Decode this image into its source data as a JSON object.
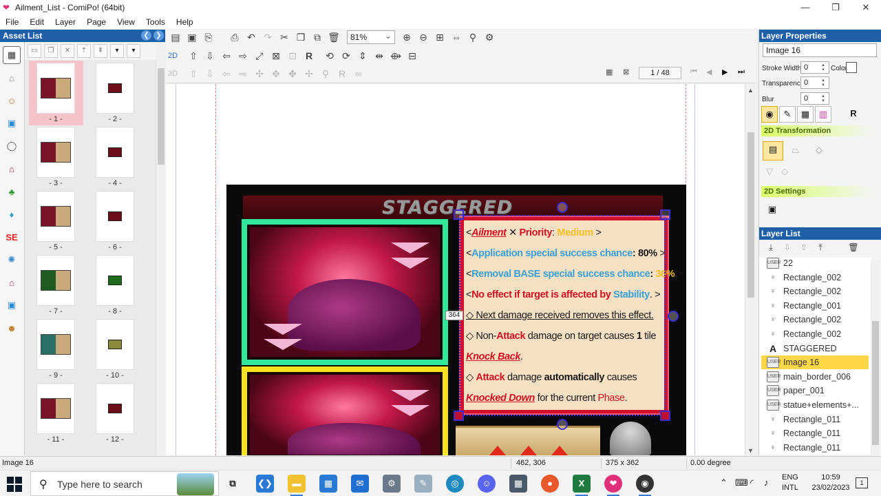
{
  "window": {
    "title": "Ailment_List - ComiPo! (64bit)",
    "controls": [
      "—",
      "❐",
      "✕"
    ]
  },
  "menu": [
    "File",
    "Edit",
    "Layer",
    "Page",
    "View",
    "Tools",
    "Help"
  ],
  "asset_list": {
    "title": "Asset List",
    "pages": [
      {
        "label": "- 1 -",
        "variant": "red-big"
      },
      {
        "label": "- 2 -",
        "variant": "red-small"
      },
      {
        "label": "- 3 -",
        "variant": "red-big"
      },
      {
        "label": "- 4 -",
        "variant": "red-small"
      },
      {
        "label": "- 5 -",
        "variant": "red-big"
      },
      {
        "label": "- 6 -",
        "variant": "red-small"
      },
      {
        "label": "- 7 -",
        "variant": "green-big"
      },
      {
        "label": "- 8 -",
        "variant": "green-small"
      },
      {
        "label": "- 9 -",
        "variant": "teal-big"
      },
      {
        "label": "- 10 -",
        "variant": "teal-small"
      },
      {
        "label": "- 11 -",
        "variant": "red-big"
      },
      {
        "label": "- 12 -",
        "variant": "red-small"
      }
    ]
  },
  "toolbar": {
    "zoom": "81%",
    "mode_2d": "2D",
    "mode_3d": "3D",
    "page_counter": "1 / 48"
  },
  "canvas": {
    "comic_title": "STAGGERED",
    "size_tag": "364",
    "card_lines": {
      "l1_a": "<",
      "l1_ailment": "Ailment",
      "l1_x": " ✕ ",
      "l1_priority": "Priority",
      "l1_colon": ": ",
      "l1_medium": "Medium",
      "l1_end": " >",
      "l2_a": "<",
      "l2_blue": "Application special success chance",
      "l2_val": ": 80%",
      "l2_end": " >",
      "l3_a": "<",
      "l3_blue": "Removal BASE special success chance",
      "l3_colon": ": ",
      "l3_gold": "36%",
      "l3_end": " >",
      "l4_a": "<",
      "l4_red": "No effect if target is affected by ",
      "l4_blue": "Stability",
      "l4_end": ". >",
      "l5": "◇ Next damage received removes this effect.",
      "l6_a": "◇ Non-",
      "l6_attack": "Attack",
      "l6_b": " damage on target causes ",
      "l6_one": "1",
      "l6_c": " tile",
      "l7_kb": "Knock Back",
      "l7_dot": ".",
      "l8_a": "◇ ",
      "l8_attack": "Attack",
      "l8_b": " damage ",
      "l8_auto": "automatically",
      "l8_c": " causes",
      "l9_kd": "Knocked Down",
      "l9_b": " for the current ",
      "l9_phase": "Phase",
      "l9_dot": "."
    }
  },
  "layer_properties": {
    "title": "Layer Properties",
    "name": "Image 16",
    "stroke_width_label": "Stroke Width",
    "stroke_width": "0",
    "color_label": "Color",
    "transparency_label": "Transparency",
    "transparency": "0",
    "blur_label": "Blur",
    "blur": "0",
    "transformation_label": "2D Transformation",
    "settings_label": "2D Settings"
  },
  "layer_list": {
    "title": "Layer List",
    "items": [
      {
        "name": "22",
        "icon": "image"
      },
      {
        "name": "Rectangle_002",
        "icon": "shape"
      },
      {
        "name": "Rectangle_002",
        "icon": "shape"
      },
      {
        "name": "Rectangle_001",
        "icon": "shape"
      },
      {
        "name": "Rectangle_002",
        "icon": "shape"
      },
      {
        "name": "Rectangle_002",
        "icon": "shape"
      },
      {
        "name": "STAGGERED",
        "icon": "text"
      },
      {
        "name": "Image 16",
        "icon": "image",
        "selected": true
      },
      {
        "name": "main_border_006",
        "icon": "image"
      },
      {
        "name": "paper_001",
        "icon": "image"
      },
      {
        "name": "statue+elements+...",
        "icon": "image"
      },
      {
        "name": "Rectangle_011",
        "icon": "shape"
      },
      {
        "name": "Rectangle_011",
        "icon": "shape"
      },
      {
        "name": "Rectangle_011",
        "icon": "shape"
      }
    ]
  },
  "status": {
    "layer": "Image 16",
    "coords": "462, 306",
    "size": "375 x 362",
    "angle": "0.00 degree"
  },
  "taskbar": {
    "search_placeholder": "Type here to search",
    "lang_top": "ENG",
    "lang_bottom": "INTL",
    "time": "10:59",
    "date": "23/02/2023",
    "notifications": "1"
  }
}
